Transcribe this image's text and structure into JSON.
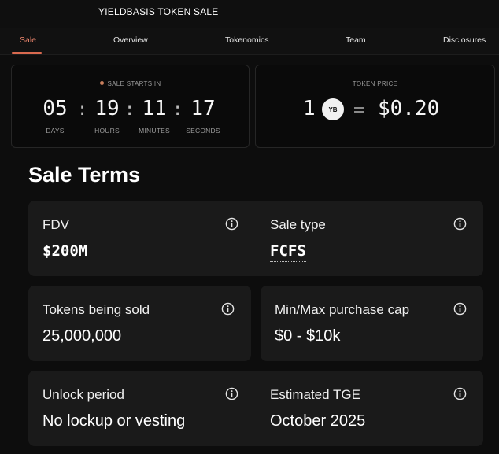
{
  "header": {
    "title": "YIELDBASIS TOKEN SALE"
  },
  "tabs": [
    {
      "label": "Sale",
      "active": true
    },
    {
      "label": "Overview"
    },
    {
      "label": "Tokenomics"
    },
    {
      "label": "Team"
    },
    {
      "label": "Disclosures"
    }
  ],
  "countdown": {
    "label": "SALE STARTS IN",
    "days": "05",
    "hours": "19",
    "minutes": "11",
    "seconds": "17",
    "days_label": "DAYS",
    "hours_label": "HOURS",
    "minutes_label": "MINUTES",
    "seconds_label": "SECONDS",
    "separator": ":"
  },
  "token_price": {
    "label": "TOKEN PRICE",
    "amount": "1",
    "token_symbol": "YB",
    "equals": "=",
    "price": "$0.20"
  },
  "sale_terms": {
    "title": "Sale Terms",
    "items": [
      {
        "label": "FDV",
        "value": "$200M"
      },
      {
        "label": "Sale type",
        "value": "FCFS"
      },
      {
        "label": "Tokens being sold",
        "value": "25,000,000"
      },
      {
        "label": "Min/Max purchase cap",
        "value": "$0 - $10k"
      },
      {
        "label": "Unlock period",
        "value": "No lockup or vesting"
      },
      {
        "label": "Estimated TGE",
        "value": "October 2025"
      }
    ]
  },
  "colors": {
    "accent": "#d8694f",
    "background": "#0d0d0d",
    "card": "#1a1a1a"
  }
}
